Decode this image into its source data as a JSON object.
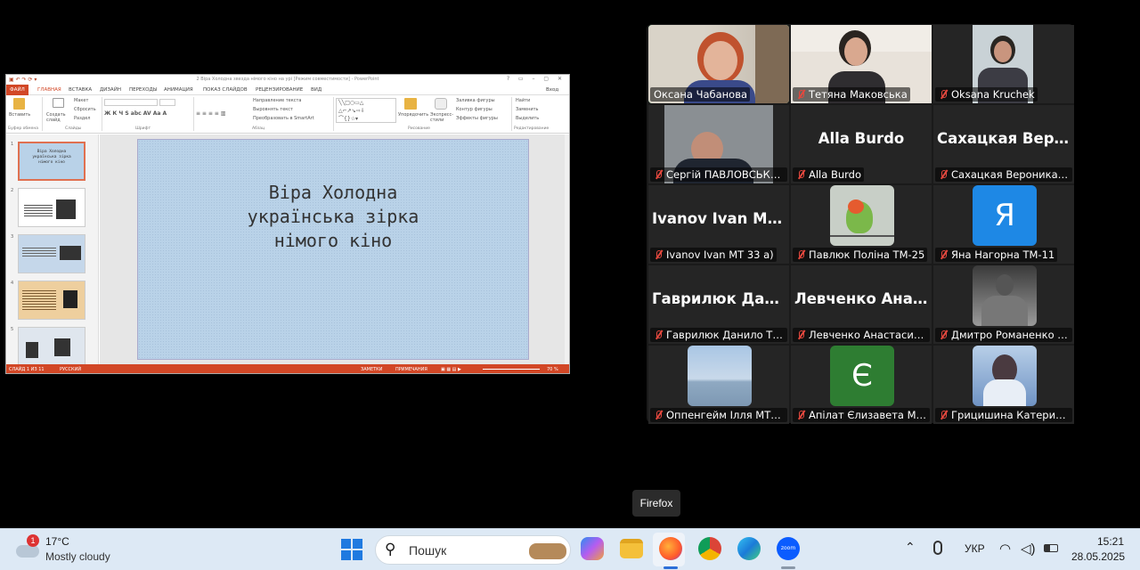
{
  "ppt": {
    "window_title": "2 Віра Холодна звезда німого кіно на урі [Режим совместимости] - PowerPoint",
    "tabs": [
      "ФАЙЛ",
      "ГЛАВНАЯ",
      "ВСТАВКА",
      "ДИЗАЙН",
      "ПЕРЕХОДЫ",
      "АНИМАЦИЯ",
      "ПОКАЗ СЛАЙДОВ",
      "РЕЦЕНЗИРОВАНИЕ",
      "ВИД"
    ],
    "signin": "Вход",
    "ribbon": {
      "paste": "Вставить",
      "new_slide": "Создать слайд",
      "layout": "Макет",
      "reset": "Сбросить",
      "section": "Раздел",
      "text_dir": "Направление текста",
      "align_text": "Выровнять текст",
      "smartart": "Преобразовать в SmartArt",
      "arrange": "Упорядочить",
      "quick_styles": "Экспресс-стили",
      "shape_fill": "Заливка фигуры",
      "shape_outline": "Контур фигуры",
      "shape_effects": "Эффекты фигуры",
      "find": "Найти",
      "replace": "Заменить",
      "select": "Выделить",
      "groups": [
        "Буфер обмена",
        "Слайды",
        "Шрифт",
        "Абзац",
        "Рисование",
        "Редактирование"
      ]
    },
    "slide_numbers": [
      "1",
      "2",
      "3",
      "4",
      "5"
    ],
    "slide_title_lines": [
      "Віра Холодна",
      "українська зірка",
      "німого кіно"
    ],
    "status": {
      "slide": "СЛАЙД 1 ИЗ 11",
      "lang": "РУССКИЙ",
      "notes": "ЗАМЕТКИ",
      "comments": "ПРИМЕЧАНИЯ",
      "zoom": "70 %"
    }
  },
  "gallery": {
    "tiles": [
      {
        "name": "Оксана Чабанова",
        "muted": false,
        "big": "",
        "active": true
      },
      {
        "name": "Тетяна Маковська",
        "muted": true,
        "big": ""
      },
      {
        "name": "Oksana Kruchek",
        "muted": true,
        "big": ""
      },
      {
        "name": "Сергій ПАВЛОВСЬКИЙ",
        "muted": true,
        "big": ""
      },
      {
        "name": "Alla Burdo",
        "muted": true,
        "big": "Alla Burdo"
      },
      {
        "name": "Сахацкая Вероника Т...",
        "muted": true,
        "big": "Сахацкая Веро..."
      },
      {
        "name": "Ivanov Ivan MT 33 a)",
        "muted": true,
        "big": "Ivanov Ivan MT..."
      },
      {
        "name": "Павлюк Поліна ТМ-25",
        "muted": true,
        "big": ""
      },
      {
        "name": "Яна Нагорна ТМ-11",
        "muted": true,
        "big": "",
        "avatar": "Я",
        "avatar_color": "#1e88e5"
      },
      {
        "name": "Гаврилюк Данило ТМ...",
        "muted": true,
        "big": "Гаврилюк Дан..."
      },
      {
        "name": "Левченко Анастасия ...",
        "muted": true,
        "big": "Левченко Анас..."
      },
      {
        "name": "Дмитро Романенко Г...",
        "muted": true,
        "big": ""
      },
      {
        "name": "Оппенгейм Ілля МТс-...",
        "muted": true,
        "big": ""
      },
      {
        "name": "Апілат Єлизавета МТ-...",
        "muted": true,
        "big": "",
        "avatar": "Є",
        "avatar_color": "#2e7d32"
      },
      {
        "name": "Грицишина Катерина...",
        "muted": true,
        "big": ""
      }
    ]
  },
  "tooltip": "Firefox",
  "taskbar": {
    "weather_badge": "1",
    "temp": "17°C",
    "weather": "Mostly cloudy",
    "search_placeholder": "Пошук",
    "lang": "УКР",
    "time": "15:21",
    "date": "28.05.2025",
    "zoom_label": "zoom"
  }
}
